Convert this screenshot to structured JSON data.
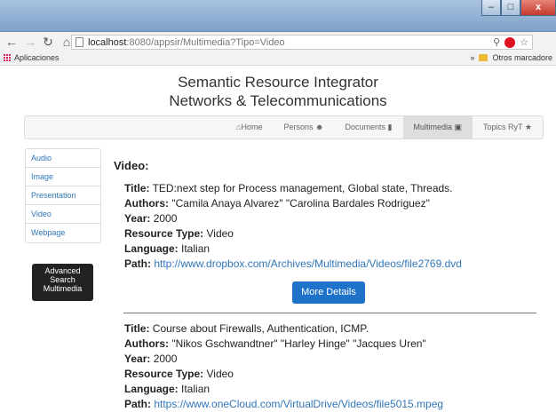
{
  "browser": {
    "window_buttons": {
      "minimize": "–",
      "maximize": "□",
      "close": "x"
    },
    "url_host": "localhost",
    "url_rest": ":8080/appsir/Multimedia?Tipo=Video",
    "bookmarks": {
      "apps_label": "Aplicaciones",
      "overflow": "»",
      "other_label": "Otros marcadore"
    }
  },
  "site": {
    "title_line1": "Semantic Resource Integrator",
    "title_line2": "Networks & Telecommunications"
  },
  "nav": {
    "items": [
      {
        "label": "Home",
        "icon": "home-icon"
      },
      {
        "label": "Persons",
        "icon": "user-icon"
      },
      {
        "label": "Documents",
        "icon": "document-icon"
      },
      {
        "label": "Multimedia",
        "icon": "film-icon",
        "active": true
      },
      {
        "label": "Topics RyT",
        "icon": "star-icon"
      }
    ]
  },
  "sidebar": {
    "items": [
      "Audio",
      "Image",
      "Presentation",
      "Video",
      "Webpage"
    ],
    "advanced_button": "Advanced Search Multimedia"
  },
  "main": {
    "section_title": "Video:",
    "labels": {
      "title": "Title:",
      "authors": "Authors:",
      "year": "Year:",
      "type": "Resource Type:",
      "language": "Language:",
      "path": "Path:"
    },
    "records": [
      {
        "title": "TED:next step for Process management, Global state, Threads.",
        "authors": "\"Camila Anaya Alvarez\" \"Carolina Bardales Rodriguez\"",
        "year": "2000",
        "type": "Video",
        "language": "Italian",
        "path": "http://www.dropbox.com/Archives/Multimedia/Videos/file2769.dvd"
      },
      {
        "title": "Course about Firewalls, Authentication, ICMP.",
        "authors": "\"Nikos Gschwandtner\" \"Harley Hinge\" \"Jacques Uren\"",
        "year": "2000",
        "type": "Video",
        "language": "Italian",
        "path": "https://www.oneCloud.com/VirtualDrive/Videos/file5015.mpeg"
      }
    ],
    "more_details": "More Details"
  }
}
